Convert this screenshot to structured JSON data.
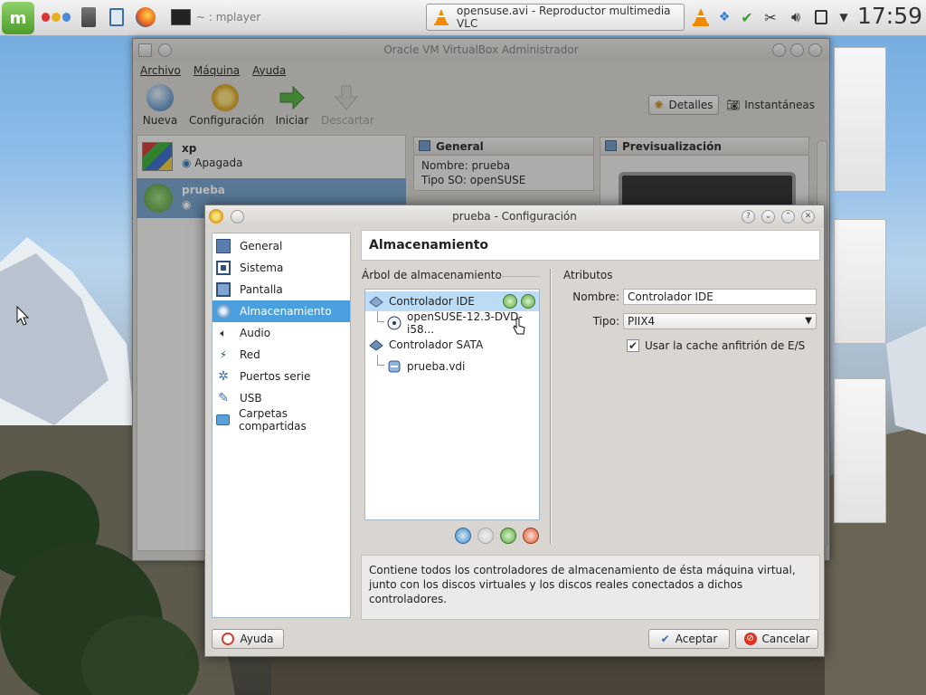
{
  "panel": {
    "terminal_task": "~ : mplayer",
    "vlc_task": "opensuse.avi - Reproductor multimedia VLC",
    "clock": "17:59"
  },
  "manager": {
    "title": "Oracle VM VirtualBox Administrador",
    "menu": [
      "Archivo",
      "Máquina",
      "Ayuda"
    ],
    "toolbar": [
      "Nueva",
      "Configuración",
      "Iniciar",
      "Descartar"
    ],
    "tabs": [
      "Detalles",
      "Instantáneas"
    ],
    "vms": [
      {
        "name": "xp",
        "state": "Apagada"
      },
      {
        "name": "prueba",
        "state": ""
      }
    ],
    "general_header": "General",
    "general_name": "Nombre: prueba",
    "general_os": "Tipo SO:  openSUSE",
    "preview_header": "Previsualización"
  },
  "dialog": {
    "title": "prueba - Configuración",
    "categories": [
      {
        "label": "General",
        "icon": "general-icon"
      },
      {
        "label": "Sistema",
        "icon": "system-icon"
      },
      {
        "label": "Pantalla",
        "icon": "display-icon"
      },
      {
        "label": "Almacenamiento",
        "icon": "storage-icon",
        "selected": true
      },
      {
        "label": "Audio",
        "icon": "audio-icon"
      },
      {
        "label": "Red",
        "icon": "network-icon"
      },
      {
        "label": "Puertos serie",
        "icon": "serial-port-icon"
      },
      {
        "label": "USB",
        "icon": "usb-icon"
      },
      {
        "label": "Carpetas compartidas",
        "icon": "shared-folder-icon"
      }
    ],
    "page_title": "Almacenamiento",
    "tree_label": "Árbol de almacenamiento",
    "tree": {
      "ide_controller": "Controlador IDE",
      "ide_disc": "openSUSE-12.3-DVD-i58...",
      "sata_controller": "Controlador SATA",
      "sata_disk": "prueba.vdi"
    },
    "attributes_label": "Atributos",
    "name_label": "Nombre:",
    "name_value": "Controlador IDE",
    "type_label": "Tipo:",
    "type_value": "PIIX4",
    "cache_label": "Usar la cache anfitrión de E/S",
    "cache_checked": true,
    "info_text": "Contiene todos los controladores de almacenamiento de ésta máquina virtual, junto con los discos virtuales y los discos reales conectados a dichos controladores.",
    "help_button": "Ayuda",
    "accept_button": "Aceptar",
    "cancel_button": "Cancelar"
  }
}
